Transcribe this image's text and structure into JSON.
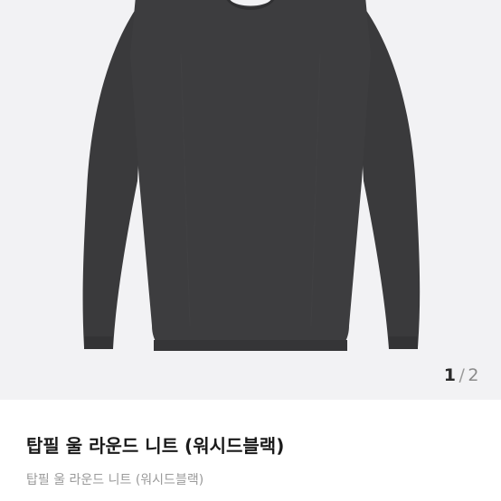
{
  "gallery": {
    "image_alt": "product-photo-sweater",
    "sweater_color": "#3c3c3e",
    "background_color": "#f2f2f4",
    "current_index": "1",
    "separator": "/",
    "total": "2"
  },
  "product": {
    "title": "탑필 울 라운드 니트 (워시드블랙)",
    "subtitle": "탑필 울 라운드 니트 (워시드블랙)"
  }
}
